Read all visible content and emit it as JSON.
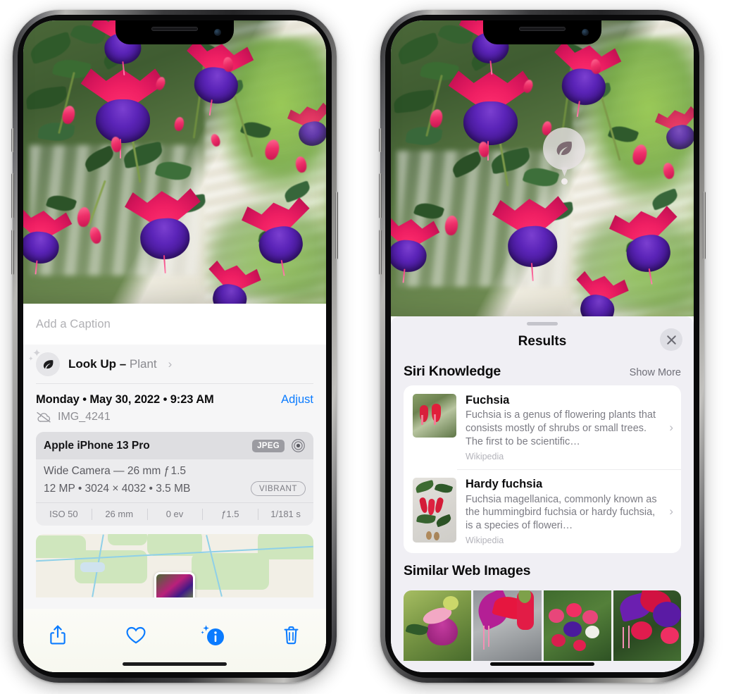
{
  "left_phone": {
    "name": "iphone-photos-info",
    "caption_field": {
      "placeholder": "Add a Caption",
      "value": ""
    },
    "lookup_row": {
      "icon": "leaf-icon",
      "label": "Look Up – ",
      "subject": "Plant",
      "chevron": "›"
    },
    "metadata": {
      "date": "Monday • May 30, 2022 • 9:23 AM",
      "adjust_label": "Adjust",
      "cloud_icon": "cloud-slash-icon",
      "filename": "IMG_4241"
    },
    "exif": {
      "device": "Apple iPhone 13 Pro",
      "format_badge": "JPEG",
      "lens_icon": "aperture-icon",
      "lens_line": "Wide Camera — 26 mm ƒ 1.5",
      "size_line": "12 MP • 3024 × 4032 • 3.5 MB",
      "style_badge": "VIBRANT",
      "stats": [
        "ISO 50",
        "26 mm",
        "0 ev",
        "ƒ1.5",
        "1/181 s"
      ]
    },
    "map": {
      "name": "location-map",
      "pin": "photo-pin"
    },
    "toolbar": [
      {
        "name": "share-button",
        "icon": "share-icon"
      },
      {
        "name": "favorite-button",
        "icon": "heart-icon"
      },
      {
        "name": "info-button",
        "icon": "info-sparkle-icon"
      },
      {
        "name": "delete-button",
        "icon": "trash-icon"
      }
    ]
  },
  "right_phone": {
    "name": "iphone-visual-lookup-results",
    "photo_badge": {
      "icon": "leaf-icon"
    },
    "sheet": {
      "grabber": "drag-handle",
      "title": "Results",
      "close_label": "✕"
    },
    "siri_knowledge": {
      "title": "Siri Knowledge",
      "action": "Show More",
      "items": [
        {
          "title": "Fuchsia",
          "desc": "Fuchsia is a genus of flowering plants that consists mostly of shrubs or small trees. The first to be scientific…",
          "source": "Wikipedia",
          "chevron": "›"
        },
        {
          "title": "Hardy fuchsia",
          "desc": "Fuchsia magellanica, commonly known as the hummingbird fuchsia or hardy fuchsia, is a species of floweri…",
          "source": "Wikipedia",
          "chevron": "›"
        }
      ]
    },
    "similar_web_images": {
      "title": "Similar Web Images",
      "count": 4
    }
  },
  "colors": {
    "ios_blue": "#0a7bff",
    "sheet_bg": "#f0eff4",
    "panel_bg": "#f6f6f7",
    "card_bg": "#ffffff",
    "exif_bg": "#ececee",
    "exif_head_bg": "#dedee1",
    "secondary_text": "#8e8e93"
  }
}
